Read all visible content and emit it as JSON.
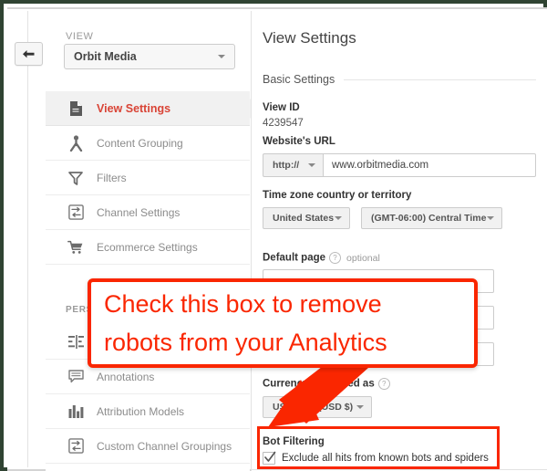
{
  "window": {
    "back_button_icon": "back-arrow-icon",
    "frame_color": "#2f4332"
  },
  "sidebar": {
    "group_label_top": "VIEW",
    "view_selector": {
      "value": "Orbit Media",
      "caret_icon": "chevron-down-icon"
    },
    "items": [
      {
        "label": "View Settings",
        "icon": "document-icon",
        "active": true
      },
      {
        "label": "Content Grouping",
        "icon": "content-grouping-icon",
        "active": false
      },
      {
        "label": "Filters",
        "icon": "funnel-icon",
        "active": false
      },
      {
        "label": "Channel Settings",
        "icon": "channel-settings-icon",
        "active": false
      },
      {
        "label": "Ecommerce Settings",
        "icon": "shopping-cart-icon",
        "active": false
      }
    ],
    "group_label_personal": "PERS",
    "items2": [
      {
        "label": "",
        "icon": "segments-icon",
        "active": false
      },
      {
        "label": "Annotations",
        "icon": "annotations-icon",
        "active": false
      },
      {
        "label": "Attribution Models",
        "icon": "bar-chart-icon",
        "active": false
      },
      {
        "label": "Custom Channel Groupings",
        "icon": "channel-settings-icon",
        "active": false
      }
    ]
  },
  "panel": {
    "title": "View Settings",
    "section_basic": "Basic Settings",
    "view_id_label": "View ID",
    "view_id_value": "4239547",
    "website_url_label": "Website's URL",
    "protocol_value": "http://",
    "website_url_value": "www.orbitmedia.com",
    "timezone_label": "Time zone country or territory",
    "timezone_country": "United States",
    "timezone_zone": "(GMT-06:00) Central Time",
    "default_page_label": "Default page",
    "default_page_optional": "optional",
    "help_icon": "question-mark-icon",
    "currency_label": "Currency displayed as",
    "currency_value": "US Dollar (USD $)",
    "bot_filtering_title": "Bot Filtering",
    "bot_filtering_checkbox_label": "Exclude all hits from known bots and spiders",
    "bot_filtering_checked": true
  },
  "annotation": {
    "callout_line1": "Check this box to remove",
    "callout_line2": "robots from your Analytics",
    "callout_color": "#fa2600",
    "arrow_icon": "pointer-arrow-icon",
    "highlight_target": "bot-filtering-section"
  }
}
